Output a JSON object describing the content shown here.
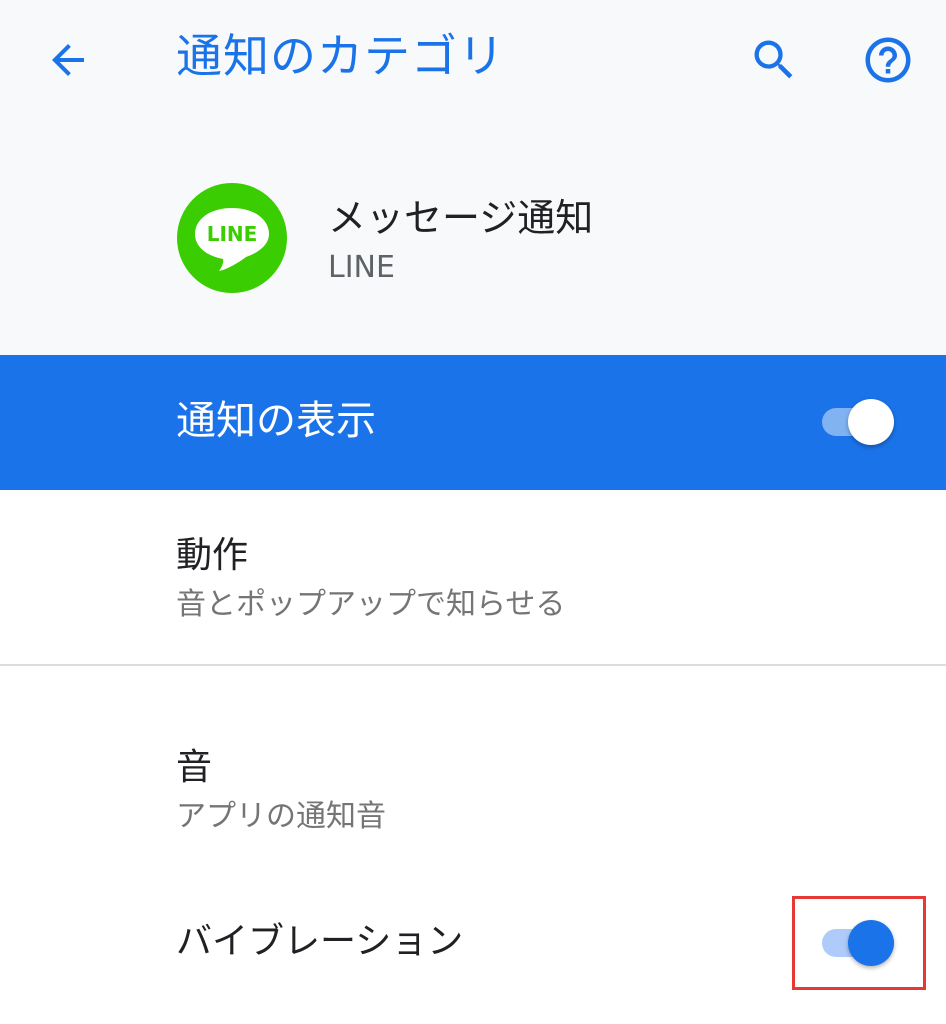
{
  "app_bar": {
    "title": "通知のカテゴリ",
    "back_icon": "arrow-back-icon",
    "search_icon": "search-icon",
    "help_icon": "help-icon"
  },
  "header": {
    "channel_name": "メッセージ通知",
    "app_name": "LINE",
    "app_icon_text": "LINE",
    "app_icon_color": "#3acd01"
  },
  "show_notifications": {
    "label": "通知の表示",
    "enabled": true
  },
  "behavior": {
    "title": "動作",
    "subtitle": "音とポップアップで知らせる"
  },
  "sound": {
    "title": "音",
    "subtitle": "アプリの通知音"
  },
  "vibration": {
    "title": "バイブレーション",
    "enabled": true
  },
  "colors": {
    "accent": "#1a73e8",
    "header_bg": "#f8f9fa",
    "highlight": "#e53935"
  }
}
